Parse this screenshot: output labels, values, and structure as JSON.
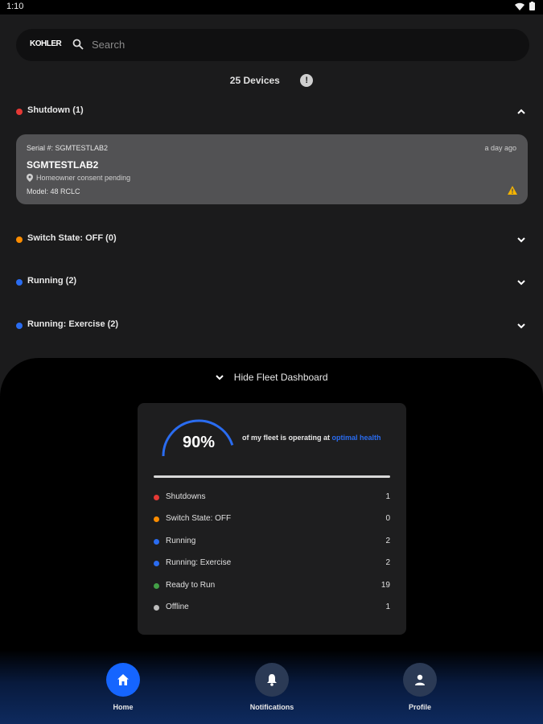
{
  "status_bar": {
    "time": "1:10"
  },
  "search": {
    "logo": "KOHLER",
    "placeholder": "Search"
  },
  "devices": {
    "count_label": "25 Devices",
    "info_icon": "!"
  },
  "groups": [
    {
      "label": "Shutdown (1)",
      "color": "#e53935",
      "expanded": true
    },
    {
      "label": "Switch State: OFF (0)",
      "color": "#fb8c00",
      "expanded": false
    },
    {
      "label": "Running (2)",
      "color": "#2a6cf0",
      "expanded": false
    },
    {
      "label": "Running: Exercise (2)",
      "color": "#2a6cf0",
      "expanded": false
    }
  ],
  "device_card": {
    "serial": "Serial #: SGMTESTLAB2",
    "time": "a day ago",
    "name": "SGMTESTLAB2",
    "location": "Homeowner consent pending",
    "model": "Model: 48 RCLC",
    "warning_icon": "warning-triangle-icon"
  },
  "dashboard": {
    "toggle_label": "Hide Fleet Dashboard",
    "health_percent": "90%",
    "health_fraction": 0.9,
    "description_prefix": "of my fleet is operating at ",
    "description_highlight": "optimal health",
    "stats": [
      {
        "label": "Shutdowns",
        "value": "1",
        "color": "#e53935"
      },
      {
        "label": "Switch State: OFF",
        "value": "0",
        "color": "#fb8c00"
      },
      {
        "label": "Running",
        "value": "2",
        "color": "#2a6cf0"
      },
      {
        "label": "Running: Exercise",
        "value": "2",
        "color": "#2a6cf0"
      },
      {
        "label": "Ready to Run",
        "value": "19",
        "color": "#43a047"
      },
      {
        "label": "Offline",
        "value": "1",
        "color": "#bdbdbd"
      }
    ]
  },
  "nav": {
    "items": [
      {
        "label": "Home",
        "icon": "home-icon",
        "active": true
      },
      {
        "label": "Notifications",
        "icon": "bell-icon",
        "active": false
      },
      {
        "label": "Profile",
        "icon": "person-icon",
        "active": false
      }
    ]
  },
  "colors": {
    "accent": "#2a6cf0",
    "card_bg": "#525254",
    "nav_inactive": "#2b3a55"
  }
}
